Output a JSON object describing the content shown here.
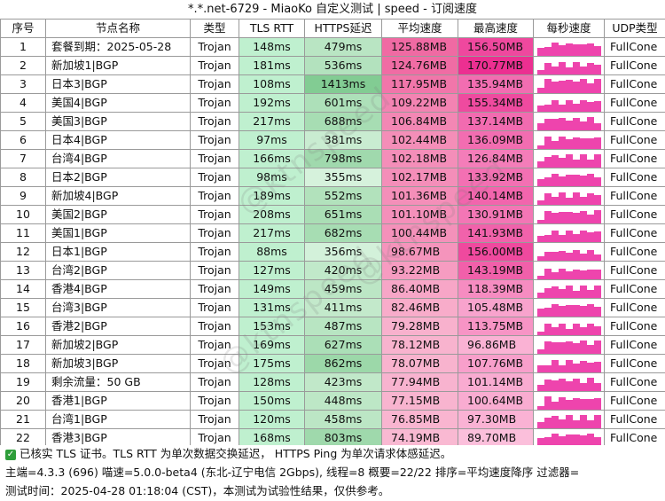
{
  "title": "*.*.net-6729 - MiaoKo 自定义测试 | speed - 订阅速度",
  "headers": [
    "序号",
    "节点名称",
    "类型",
    "TLS RTT",
    "HTTPS延迟",
    "平均速度",
    "最高速度",
    "每秒速度",
    "UDP类型"
  ],
  "rows": [
    {
      "no": "1",
      "name": "套餐到期：2025-05-28",
      "type": "Trojan",
      "rtt": "148ms",
      "https": "479ms",
      "avg": "125.88MB",
      "max": "156.50MB",
      "udp": "FullCone",
      "https_v": 479,
      "avg_v": 125.88,
      "max_v": 156.5
    },
    {
      "no": "2",
      "name": "新加坡1|BGP",
      "type": "Trojan",
      "rtt": "181ms",
      "https": "536ms",
      "avg": "124.76MB",
      "max": "170.77MB",
      "udp": "FullCone",
      "https_v": 536,
      "avg_v": 124.76,
      "max_v": 170.77
    },
    {
      "no": "3",
      "name": "日本3|BGP",
      "type": "Trojan",
      "rtt": "108ms",
      "https": "1413ms",
      "avg": "117.95MB",
      "max": "135.94MB",
      "udp": "FullCone",
      "https_v": 1413,
      "avg_v": 117.95,
      "max_v": 135.94
    },
    {
      "no": "4",
      "name": "美国4|BGP",
      "type": "Trojan",
      "rtt": "192ms",
      "https": "601ms",
      "avg": "109.22MB",
      "max": "155.34MB",
      "udp": "FullCone",
      "https_v": 601,
      "avg_v": 109.22,
      "max_v": 155.34
    },
    {
      "no": "5",
      "name": "美国3|BGP",
      "type": "Trojan",
      "rtt": "217ms",
      "https": "688ms",
      "avg": "106.84MB",
      "max": "137.14MB",
      "udp": "FullCone",
      "https_v": 688,
      "avg_v": 106.84,
      "max_v": 137.14
    },
    {
      "no": "6",
      "name": "日本4|BGP",
      "type": "Trojan",
      "rtt": "97ms",
      "https": "381ms",
      "avg": "102.44MB",
      "max": "136.09MB",
      "udp": "FullCone",
      "https_v": 381,
      "avg_v": 102.44,
      "max_v": 136.09
    },
    {
      "no": "7",
      "name": "台湾4|BGP",
      "type": "Trojan",
      "rtt": "166ms",
      "https": "798ms",
      "avg": "102.18MB",
      "max": "126.84MB",
      "udp": "FullCone",
      "https_v": 798,
      "avg_v": 102.18,
      "max_v": 126.84
    },
    {
      "no": "8",
      "name": "日本2|BGP",
      "type": "Trojan",
      "rtt": "98ms",
      "https": "355ms",
      "avg": "102.17MB",
      "max": "133.92MB",
      "udp": "FullCone",
      "https_v": 355,
      "avg_v": 102.17,
      "max_v": 133.92
    },
    {
      "no": "9",
      "name": "新加坡4|BGP",
      "type": "Trojan",
      "rtt": "189ms",
      "https": "552ms",
      "avg": "101.36MB",
      "max": "140.14MB",
      "udp": "FullCone",
      "https_v": 552,
      "avg_v": 101.36,
      "max_v": 140.14
    },
    {
      "no": "10",
      "name": "美国2|BGP",
      "type": "Trojan",
      "rtt": "208ms",
      "https": "651ms",
      "avg": "101.10MB",
      "max": "130.91MB",
      "udp": "FullCone",
      "https_v": 651,
      "avg_v": 101.1,
      "max_v": 130.91
    },
    {
      "no": "11",
      "name": "美国1|BGP",
      "type": "Trojan",
      "rtt": "217ms",
      "https": "682ms",
      "avg": "100.44MB",
      "max": "141.93MB",
      "udp": "FullCone",
      "https_v": 682,
      "avg_v": 100.44,
      "max_v": 141.93
    },
    {
      "no": "12",
      "name": "日本1|BGP",
      "type": "Trojan",
      "rtt": "88ms",
      "https": "356ms",
      "avg": "98.67MB",
      "max": "156.00MB",
      "udp": "FullCone",
      "https_v": 356,
      "avg_v": 98.67,
      "max_v": 156.0
    },
    {
      "no": "13",
      "name": "台湾2|BGP",
      "type": "Trojan",
      "rtt": "127ms",
      "https": "420ms",
      "avg": "93.22MB",
      "max": "143.19MB",
      "udp": "FullCone",
      "https_v": 420,
      "avg_v": 93.22,
      "max_v": 143.19
    },
    {
      "no": "14",
      "name": "香港4|BGP",
      "type": "Trojan",
      "rtt": "149ms",
      "https": "459ms",
      "avg": "86.40MB",
      "max": "118.39MB",
      "udp": "FullCone",
      "https_v": 459,
      "avg_v": 86.4,
      "max_v": 118.39
    },
    {
      "no": "15",
      "name": "台湾3|BGP",
      "type": "Trojan",
      "rtt": "131ms",
      "https": "411ms",
      "avg": "82.46MB",
      "max": "105.48MB",
      "udp": "FullCone",
      "https_v": 411,
      "avg_v": 82.46,
      "max_v": 105.48
    },
    {
      "no": "16",
      "name": "香港2|BGP",
      "type": "Trojan",
      "rtt": "153ms",
      "https": "487ms",
      "avg": "79.28MB",
      "max": "113.75MB",
      "udp": "FullCone",
      "https_v": 487,
      "avg_v": 79.28,
      "max_v": 113.75
    },
    {
      "no": "17",
      "name": "新加坡2|BGP",
      "type": "Trojan",
      "rtt": "169ms",
      "https": "627ms",
      "avg": "78.12MB",
      "max": "96.86MB",
      "udp": "FullCone",
      "https_v": 627,
      "avg_v": 78.12,
      "max_v": 96.86
    },
    {
      "no": "18",
      "name": "新加坡3|BGP",
      "type": "Trojan",
      "rtt": "175ms",
      "https": "862ms",
      "avg": "78.07MB",
      "max": "107.76MB",
      "udp": "FullCone",
      "https_v": 862,
      "avg_v": 78.07,
      "max_v": 107.76
    },
    {
      "no": "19",
      "name": "剩余流量：50 GB",
      "type": "Trojan",
      "rtt": "128ms",
      "https": "423ms",
      "avg": "77.94MB",
      "max": "101.14MB",
      "udp": "FullCone",
      "https_v": 423,
      "avg_v": 77.94,
      "max_v": 101.14
    },
    {
      "no": "20",
      "name": "香港1|BGP",
      "type": "Trojan",
      "rtt": "150ms",
      "https": "448ms",
      "avg": "77.15MB",
      "max": "100.64MB",
      "udp": "FullCone",
      "https_v": 448,
      "avg_v": 77.15,
      "max_v": 100.64
    },
    {
      "no": "21",
      "name": "台湾1|BGP",
      "type": "Trojan",
      "rtt": "120ms",
      "https": "458ms",
      "avg": "76.85MB",
      "max": "97.30MB",
      "udp": "FullCone",
      "https_v": 458,
      "avg_v": 76.85,
      "max_v": 97.3
    },
    {
      "no": "22",
      "name": "香港3|BGP",
      "type": "Trojan",
      "rtt": "168ms",
      "https": "803ms",
      "avg": "74.19MB",
      "max": "89.70MB",
      "udp": "FullCone",
      "https_v": 803,
      "avg_v": 74.19,
      "max_v": 89.7
    }
  ],
  "footer": {
    "line1": "已核实 TLS 证书。TLS RTT 为单次数据交换延迟，  HTTPS Ping 为单次请求体感延迟。",
    "line2": "主端=4.3.3 (696) 喵速=5.0.0-beta4 (东北-辽宁电信 2Gbps), 线程=8 概要=22/22 排序=平均速度降序 过滤器=",
    "line3": "测试时间：2025-04-28 01:18:04 (CST)，本测试为试验性结果，仅供参考。"
  },
  "watermark": "@ktnspeed",
  "colors": {
    "rtt": "#bff0cf",
    "https_lo": "#d6f2dc",
    "https_hi": "#82cc93",
    "avg_lo": "#f9b9d2",
    "avg_hi": "#f06aa3",
    "max_lo": "#fbbfdb",
    "max_hi": "#ec2f91",
    "spark": "#ee44ad",
    "check": "#2e9e3a"
  }
}
